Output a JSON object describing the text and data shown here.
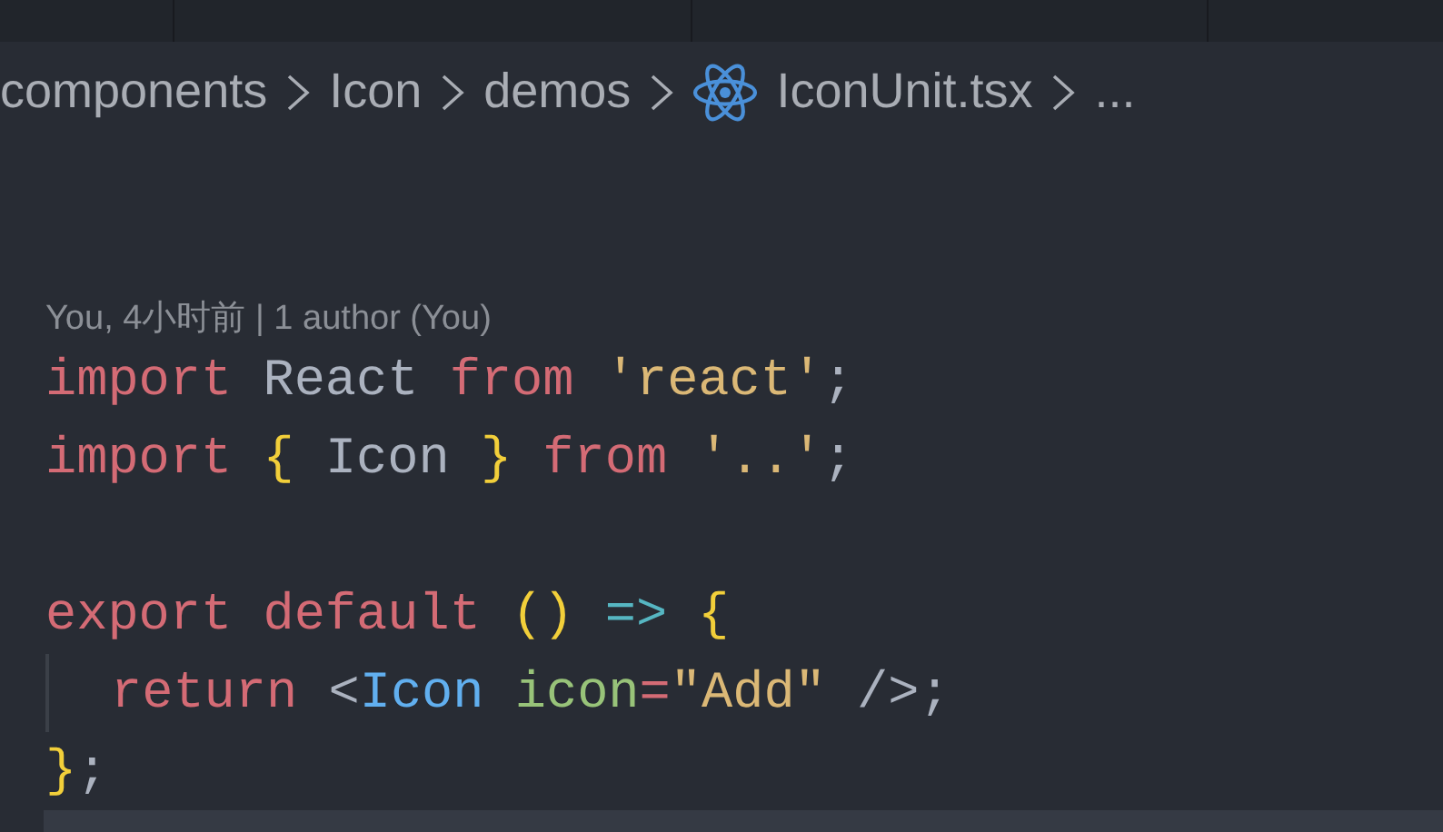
{
  "breadcrumb": [
    {
      "label": "components",
      "kind": "folder"
    },
    {
      "label": "Icon",
      "kind": "folder"
    },
    {
      "label": "demos",
      "kind": "folder"
    },
    {
      "label": "IconUnit.tsx",
      "kind": "file"
    },
    {
      "label": "...",
      "kind": "more"
    }
  ],
  "codelens": "You, 4小时前 | 1 author (You)",
  "blocks": [
    {
      "lines": [
        {
          "indented": false,
          "tokens": [
            {
              "kind": "keyword",
              "text": "import"
            },
            {
              "kind": "identifier",
              "text": " React"
            },
            {
              "kind": "keyword",
              "text": " from"
            },
            {
              "kind": "string",
              "text": " 'react'"
            },
            {
              "kind": "punct",
              "text": ";"
            }
          ]
        },
        {
          "indented": false,
          "tokens": [
            {
              "kind": "keyword",
              "text": "import"
            },
            {
              "kind": "bracket",
              "text": " {"
            },
            {
              "kind": "identifier",
              "text": " Icon"
            },
            {
              "kind": "bracket",
              "text": " }"
            },
            {
              "kind": "keyword",
              "text": " from"
            },
            {
              "kind": "string",
              "text": " '..'"
            },
            {
              "kind": "punct",
              "text": ";"
            }
          ]
        }
      ]
    },
    {
      "lines": [
        {
          "indented": false,
          "tokens": [
            {
              "kind": "keyword",
              "text": "export"
            },
            {
              "kind": "keyword",
              "text": " default"
            },
            {
              "kind": "bracket",
              "text": " ()"
            },
            {
              "kind": "operator",
              "text": " =>"
            },
            {
              "kind": "bracket",
              "text": " {"
            }
          ]
        },
        {
          "indented": true,
          "tokens": [
            {
              "kind": "keyword",
              "text": "return"
            },
            {
              "kind": "punct",
              "text": " <"
            },
            {
              "kind": "tag",
              "text": "Icon"
            },
            {
              "kind": "attr",
              "text": " icon"
            },
            {
              "kind": "keyword",
              "text": "="
            },
            {
              "kind": "string",
              "text": "\"Add\""
            },
            {
              "kind": "punct",
              "text": " />;"
            }
          ]
        },
        {
          "indented": false,
          "tokens": [
            {
              "kind": "bracket",
              "text": "}"
            },
            {
              "kind": "punct",
              "text": ";"
            }
          ]
        }
      ]
    }
  ]
}
